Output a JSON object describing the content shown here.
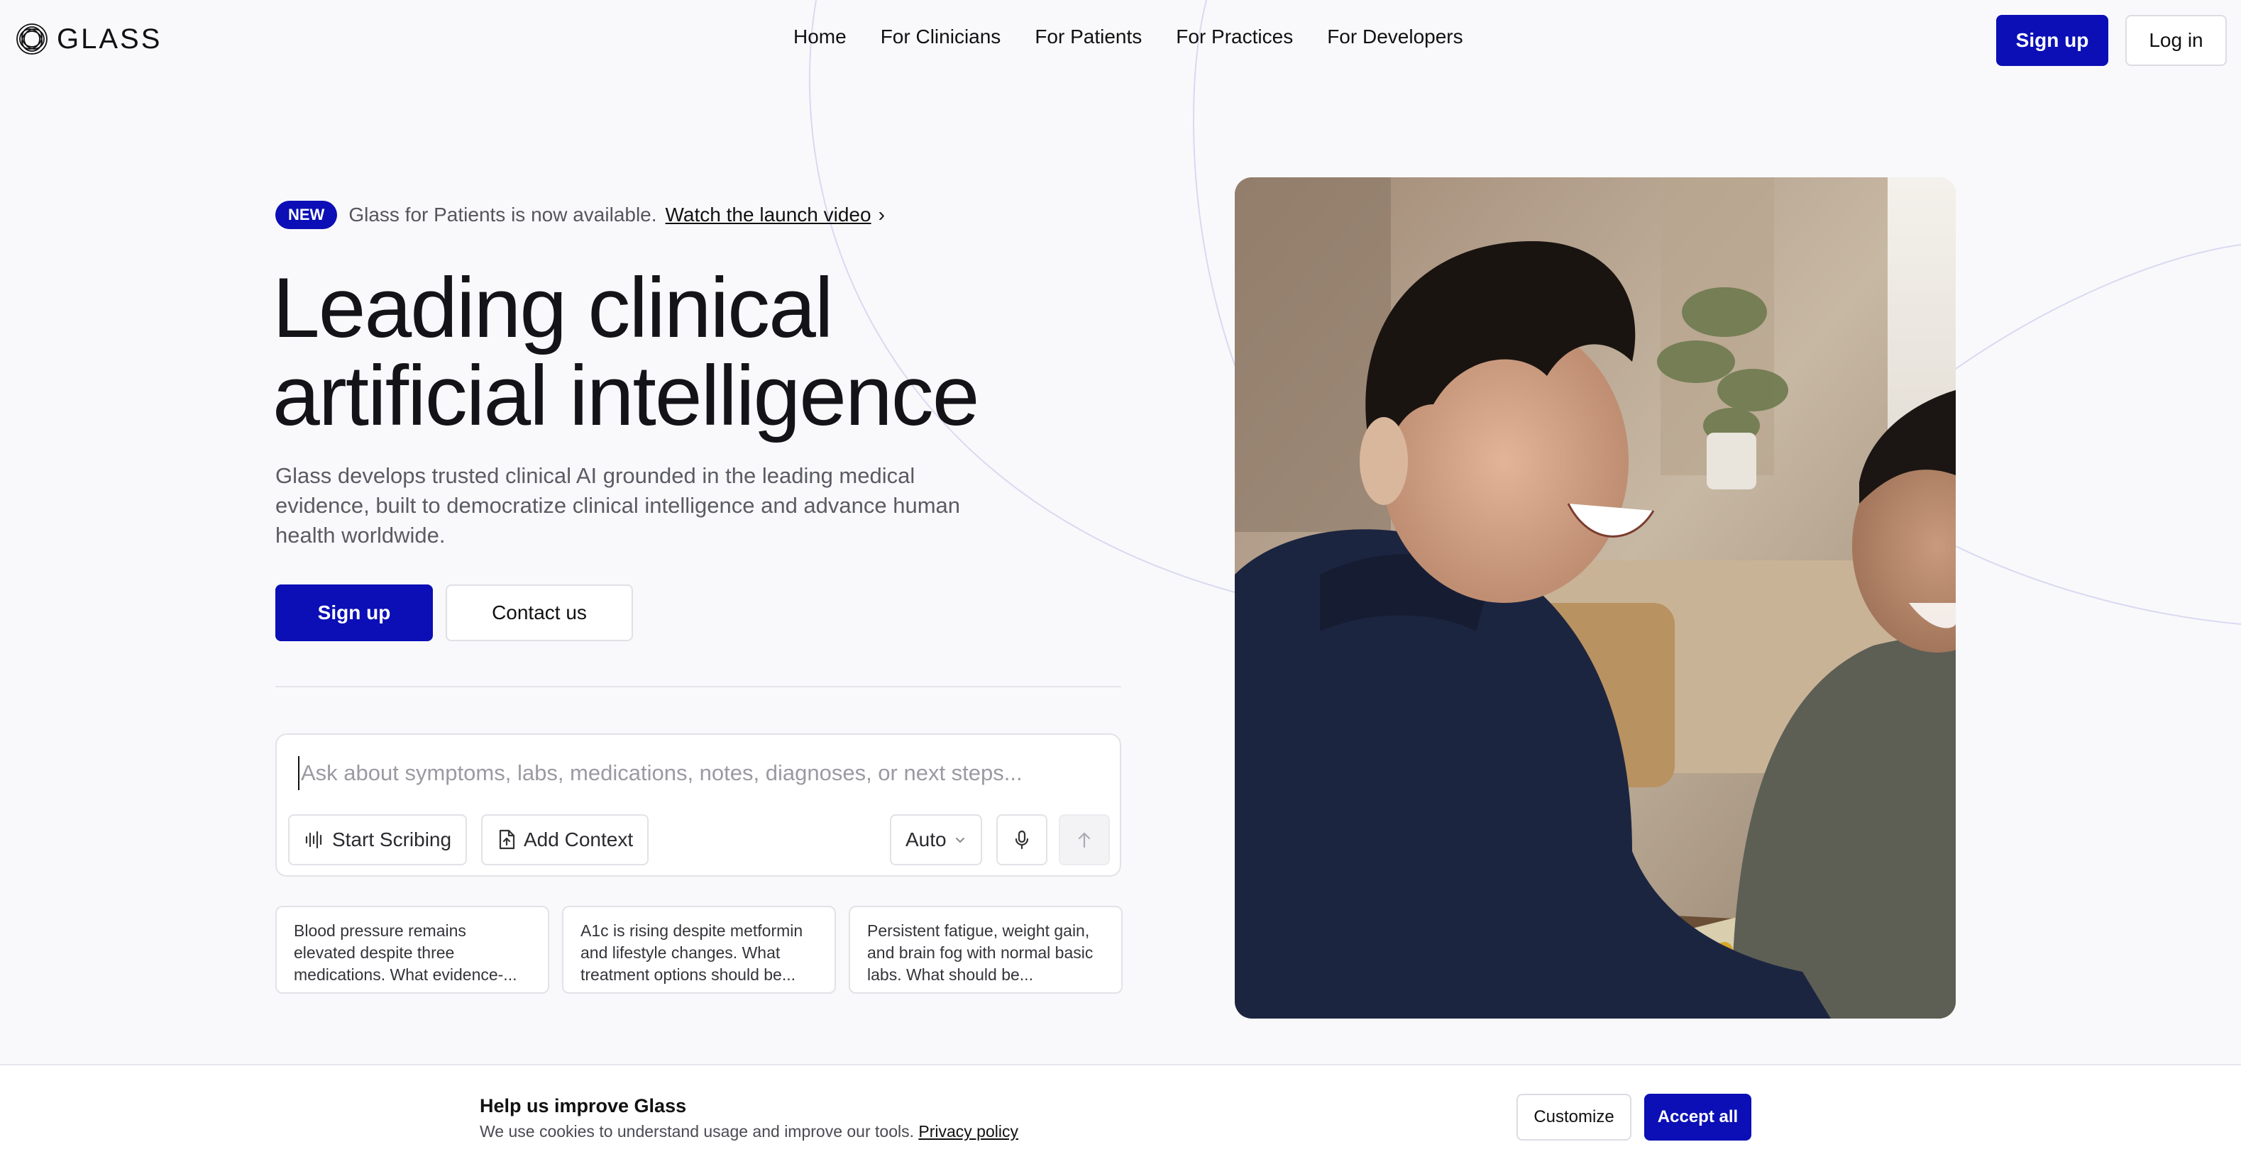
{
  "brand": {
    "name": "GLASS"
  },
  "nav": {
    "items": [
      {
        "label": "Home"
      },
      {
        "label": "For Clinicians"
      },
      {
        "label": "For Patients"
      },
      {
        "label": "For Practices"
      },
      {
        "label": "For Developers"
      }
    ],
    "signup_label": "Sign up",
    "login_label": "Log in"
  },
  "announcement": {
    "badge": "NEW",
    "text": "Glass for Patients is now available.",
    "link_label": "Watch the launch video",
    "chevron": "›"
  },
  "hero": {
    "title": "Leading clinical artificial intelligence",
    "subtitle": "Glass develops trusted clinical AI grounded in the leading medical evidence, built to democratize clinical intelligence and advance human health worldwide.",
    "signup_label": "Sign up",
    "contact_label": "Contact us"
  },
  "ask": {
    "placeholder": "Ask about symptoms, labs, medications, notes, diagnoses, or next steps...",
    "value": "",
    "scribe_label": "Start Scribing",
    "context_label": "Add Context",
    "mode_label": "Auto",
    "icons": {
      "scribe": "waveform-icon",
      "context": "file-upload-icon",
      "mode": "chevron-down-icon",
      "mic": "microphone-icon",
      "send": "arrow-up-icon"
    }
  },
  "suggestions": [
    {
      "text": "Blood pressure remains elevated despite three medications. What evidence-..."
    },
    {
      "text": "A1c is rising despite metformin and lifestyle changes. What treatment options should be..."
    },
    {
      "text": "Persistent fatigue, weight gain, and brain fog with normal basic labs. What should be..."
    }
  ],
  "cookie": {
    "title": "Help us improve Glass",
    "text": "We use cookies to understand usage and improve our tools.",
    "link_label": "Privacy policy",
    "customize_label": "Customize",
    "accept_label": "Accept all"
  },
  "colors": {
    "accent": "#0b0fb5",
    "background": "#f9f9fb",
    "text": "#111114",
    "muted": "#5b5b63"
  }
}
